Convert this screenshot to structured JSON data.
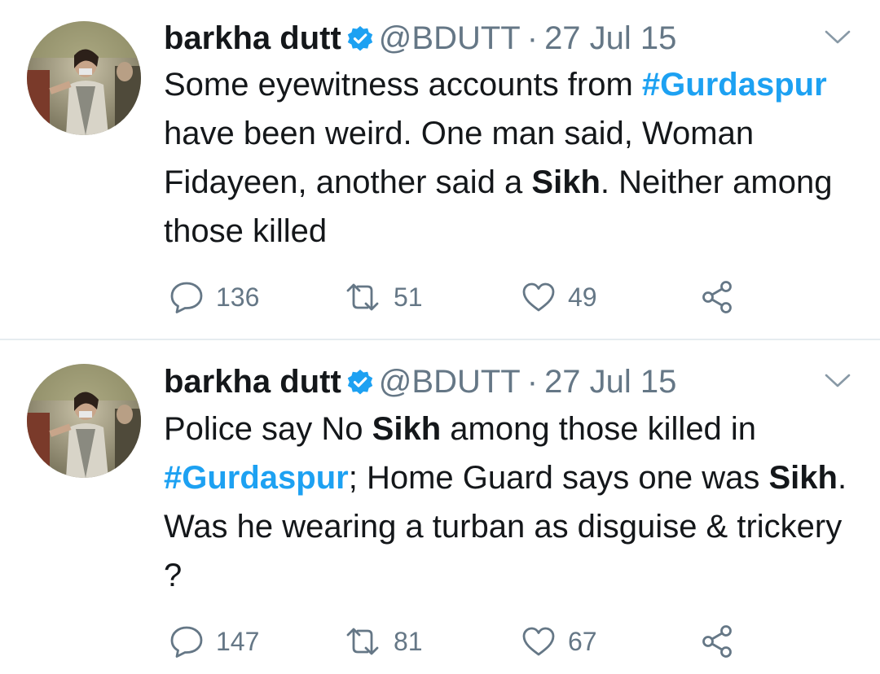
{
  "tweets": [
    {
      "name": "barkha dutt",
      "handle": "@BDUTT",
      "separator": "·",
      "date": "27 Jul 15",
      "text_segments": [
        {
          "text": "Some eyewitness accounts from ",
          "style": "plain"
        },
        {
          "text": "#Gurdaspur",
          "style": "hashtag"
        },
        {
          "text": " have been weird. One man said, Woman Fidayeen, another said a ",
          "style": "plain"
        },
        {
          "text": "Sikh",
          "style": "bold"
        },
        {
          "text": ". Neither among those killed",
          "style": "plain"
        }
      ],
      "replies": "136",
      "retweets": "51",
      "likes": "49"
    },
    {
      "name": "barkha dutt",
      "handle": "@BDUTT",
      "separator": "·",
      "date": "27 Jul 15",
      "text_segments": [
        {
          "text": "Police say No ",
          "style": "plain"
        },
        {
          "text": "Sikh",
          "style": "bold"
        },
        {
          "text": " among those killed in ",
          "style": "plain"
        },
        {
          "text": "#Gurdaspur",
          "style": "hashtag"
        },
        {
          "text": "; Home Guard says one was ",
          "style": "plain"
        },
        {
          "text": "Sikh",
          "style": "bold"
        },
        {
          "text": ". Was he wearing a turban as disguise & trickery ?",
          "style": "plain"
        }
      ],
      "replies": "147",
      "retweets": "81",
      "likes": "67"
    }
  ],
  "icons": {
    "verified": "verified-badge-icon",
    "caret": "chevron-down-icon",
    "reply": "reply-bubble-icon",
    "retweet": "retweet-icon",
    "like": "heart-icon",
    "share": "share-icon"
  },
  "colors": {
    "accent": "#1da1f2",
    "text": "#14171a",
    "secondary": "#657786",
    "divider": "#e6ecf0"
  }
}
